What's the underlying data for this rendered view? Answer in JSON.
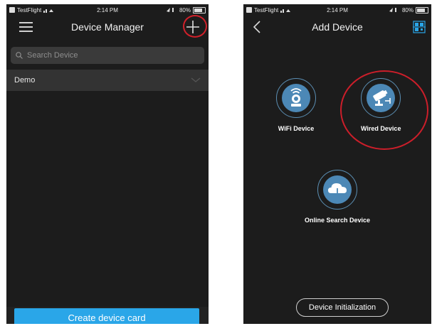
{
  "left_screen": {
    "status": {
      "carrier": "TestFlight",
      "time": "2:14 PM",
      "battery": "80%"
    },
    "title": "Device Manager",
    "search_placeholder": "Search Device",
    "group_name": "Demo",
    "create_button": "Create device card"
  },
  "right_screen": {
    "status": {
      "carrier": "TestFlight",
      "time": "2:14 PM",
      "battery": "80%"
    },
    "title": "Add Device",
    "options": {
      "wifi": "WiFi Device",
      "wired": "Wired Device",
      "online_search": "Online Search Device"
    },
    "init_button": "Device Initialization"
  },
  "colors": {
    "background": "#1c1c1c",
    "accent_blue": "#2aa6e8",
    "highlight_red": "#cc1e2a",
    "icon_circle": "#4c88b6"
  },
  "icons": [
    "menu-icon",
    "plus-icon",
    "search-icon",
    "chevron-down-icon",
    "back-chevron-icon",
    "qr-scan-icon",
    "wifi-camera-icon",
    "wired-camera-icon",
    "cloud-download-icon"
  ]
}
